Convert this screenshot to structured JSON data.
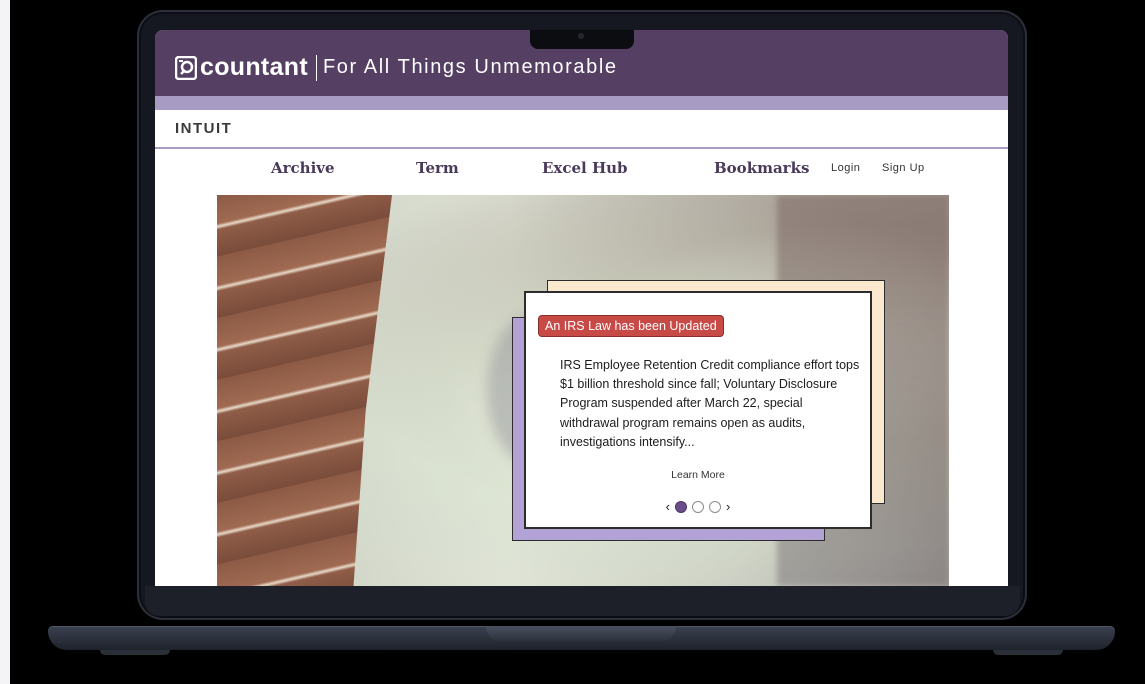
{
  "header": {
    "logo_text": "countant",
    "tagline": "For All Things Unmemorable",
    "brand_color": "#553f62",
    "band_color": "#a89bc3"
  },
  "intuit": {
    "logo": "INTUIT"
  },
  "nav": {
    "items": [
      "Archive",
      "Term",
      "Excel Hub",
      "Bookmarks"
    ],
    "login": "Login",
    "signup": "Sign Up"
  },
  "card": {
    "badge": "An IRS Law has been Updated",
    "body": "IRS Employee Retention Credit compliance effort tops $1 billion threshold since fall; Voluntary Disclosure Program suspended after March 22, special withdrawal program remains open as audits, investigations intensify...",
    "learn_more": "Learn More",
    "prev_icon": "chevron-left-icon",
    "next_icon": "chevron-right-icon",
    "slides": 3,
    "active_slide": 1,
    "badge_color": "#c84a47"
  }
}
